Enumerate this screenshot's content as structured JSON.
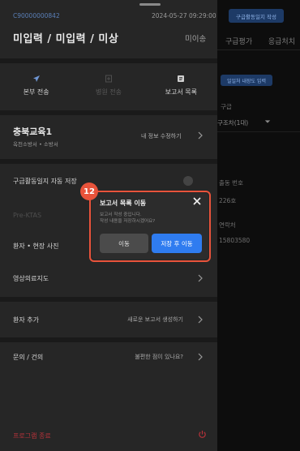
{
  "background": {
    "top_button": "구급활동일지 작성",
    "tabs": [
      "구급평가",
      "응급처치"
    ],
    "load_button": "일일처 내장도 입력",
    "texts": [
      "구급",
      "구조차(1대)",
      "출동 번호",
      "226호",
      "연락처",
      "15803580"
    ]
  },
  "header": {
    "record_id": "C90000000842",
    "datetime": "2024-05-27 09:29:00",
    "title": "미입력 / 미입력 / 미상",
    "status": "미이송"
  },
  "actions": [
    {
      "label": "본부 전송",
      "icon": "send-icon",
      "enabled": true
    },
    {
      "label": "병원 전송",
      "icon": "hospital-icon",
      "enabled": false
    },
    {
      "label": "보고서 목록",
      "icon": "list-icon",
      "enabled": true
    }
  ],
  "org": {
    "name": "충북교육1",
    "sub": "옥천소방서 • 소방서",
    "edit_label": "내 정보 수정하기"
  },
  "menu": {
    "autosave": "구급활동일지 자동 저장",
    "prektas": "Pre-KTAS",
    "photos": "환자 • 현장 사진",
    "video": "영상의료지도",
    "add_patient": "환자 추가",
    "add_patient_hint": "새로운 보고서 생성하기",
    "inquiry": "문의 / 건의",
    "inquiry_hint": "불편한 점이 있나요?",
    "exit": "프로그램 종료"
  },
  "modal": {
    "badge": "12",
    "title": "보고서 목록 이동",
    "message_line1": "보고서 작성 중입니다.",
    "message_line2": "작성 내용을 저장하시겠어요?",
    "cancel_label": "이동",
    "confirm_label": "저장 후 이동"
  },
  "colors": {
    "accent_blue": "#2f7cf0",
    "annotation_red": "#e8533b",
    "exit_red": "#b8323a"
  }
}
